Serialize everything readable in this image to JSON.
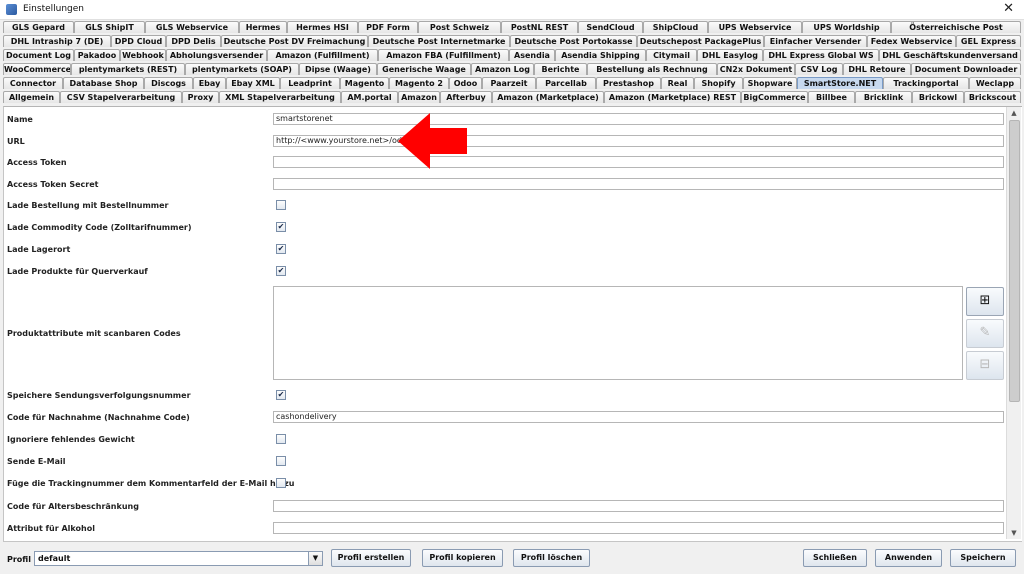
{
  "window": {
    "title": "Einstellungen",
    "close_glyph": "✕"
  },
  "tab_rows": [
    [
      "GLS Gepard",
      "GLS ShipIT",
      "GLS Webservice",
      "Hermes",
      "Hermes HSI",
      "PDF Form",
      "Post Schweiz",
      "PostNL REST",
      "SendCloud",
      "ShipCloud",
      "UPS Webservice",
      "UPS Worldship",
      "Österreichische Post"
    ],
    [
      "DHL Intraship 7 (DE)",
      "DPD Cloud",
      "DPD Delis",
      "Deutsche Post DV Freimachung",
      "Deutsche Post Internetmarke",
      "Deutsche Post Portokasse",
      "Deutschepost PackagePlus",
      "Einfacher Versender",
      "Fedex Webservice",
      "GEL Express"
    ],
    [
      "Document Log",
      "Pakadoo",
      "Webhook",
      "Abholungsversender",
      "Amazon (Fulfillment)",
      "Amazon FBA (Fulfillment)",
      "Asendia",
      "Asendia Shipping",
      "Citymail",
      "DHL Easylog",
      "DHL Express Global WS",
      "DHL Geschäftskundenversand"
    ],
    [
      "WooCommerce",
      "plentymarkets (REST)",
      "plentymarkets (SOAP)",
      "Dipse (Waage)",
      "Generische Waage",
      "Amazon Log",
      "Berichte",
      "Bestellung als Rechnung",
      "CN2x Dokument",
      "CSV Log",
      "DHL Retoure",
      "Document Downloader"
    ],
    [
      "Connector",
      "Database Shop",
      "Discogs",
      "Ebay",
      "Ebay XML",
      "Leadprint",
      "Magento",
      "Magento 2",
      "Odoo",
      "Paarzeit",
      "Parcellab",
      "Prestashop",
      "Real",
      "Shopify",
      "Shopware",
      "SmartStore.NET",
      "Trackingportal",
      "Weclapp"
    ],
    [
      "Allgemein",
      "CSV Stapelverarbeitung",
      "Proxy",
      "XML Stapelverarbeitung",
      "AM.portal",
      "Amazon",
      "Afterbuy",
      "Amazon (Marketplace)",
      "Amazon (Marketplace) REST",
      "BigCommerce",
      "Billbee",
      "Bricklink",
      "Brickowl",
      "Brickscout"
    ]
  ],
  "selected_tab": "SmartStore.NET",
  "fields": {
    "name": {
      "label": "Name",
      "value": "smartstorenet"
    },
    "url": {
      "label": "URL",
      "value": "http://<www.yourstore.net>/odata"
    },
    "access_token": {
      "label": "Access Token",
      "value": ""
    },
    "access_token_secret": {
      "label": "Access Token Secret",
      "value": ""
    },
    "lade_bestellung": {
      "label": "Lade Bestellung mit Bestellnummer",
      "checked": false
    },
    "lade_commodity": {
      "label": "Lade Commodity Code (Zolltarifnummer)",
      "checked": true
    },
    "lade_lagerort": {
      "label": "Lade Lagerort",
      "checked": true
    },
    "lade_produkte": {
      "label": "Lade Produkte für Querverkauf",
      "checked": true
    },
    "produktattribute": {
      "label": "Produktattribute mit scanbaren Codes"
    },
    "speichere_sendung": {
      "label": "Speichere Sendungsverfolgungsnummer",
      "checked": true
    },
    "nachnahme_code": {
      "label": "Code für Nachnahme (Nachnahme Code)",
      "value": "cashondelivery"
    },
    "ignoriere_gewicht": {
      "label": "Ignoriere fehlendes Gewicht",
      "checked": false
    },
    "sende_email": {
      "label": "Sende E-Mail",
      "checked": false
    },
    "fuege_tracking": {
      "label": "Füge die Trackingnummer dem Kommentarfeld der E-Mail hinzu",
      "checked": false
    },
    "altersbeschraenkung": {
      "label": "Code für Altersbeschränkung",
      "value": ""
    },
    "alkohol": {
      "label": "Attribut für Alkohol",
      "value": ""
    }
  },
  "attr_buttons": {
    "add": "⊞",
    "edit": "✎",
    "remove": "⊟"
  },
  "check_glyph": "✔",
  "icons": {
    "add": "plus-square-icon",
    "edit": "edit-icon",
    "remove": "minus-square-icon",
    "annotation": "red-arrow-icon"
  },
  "annotation_color": "#ff0000",
  "bottom": {
    "profil_label": "Profil",
    "profil_value": "default",
    "buttons": {
      "erstellen": "Profil erstellen",
      "kopieren": "Profil kopieren",
      "loeschen": "Profil löschen",
      "schliessen": "Schließen",
      "anwenden": "Anwenden",
      "speichern": "Speichern"
    }
  }
}
